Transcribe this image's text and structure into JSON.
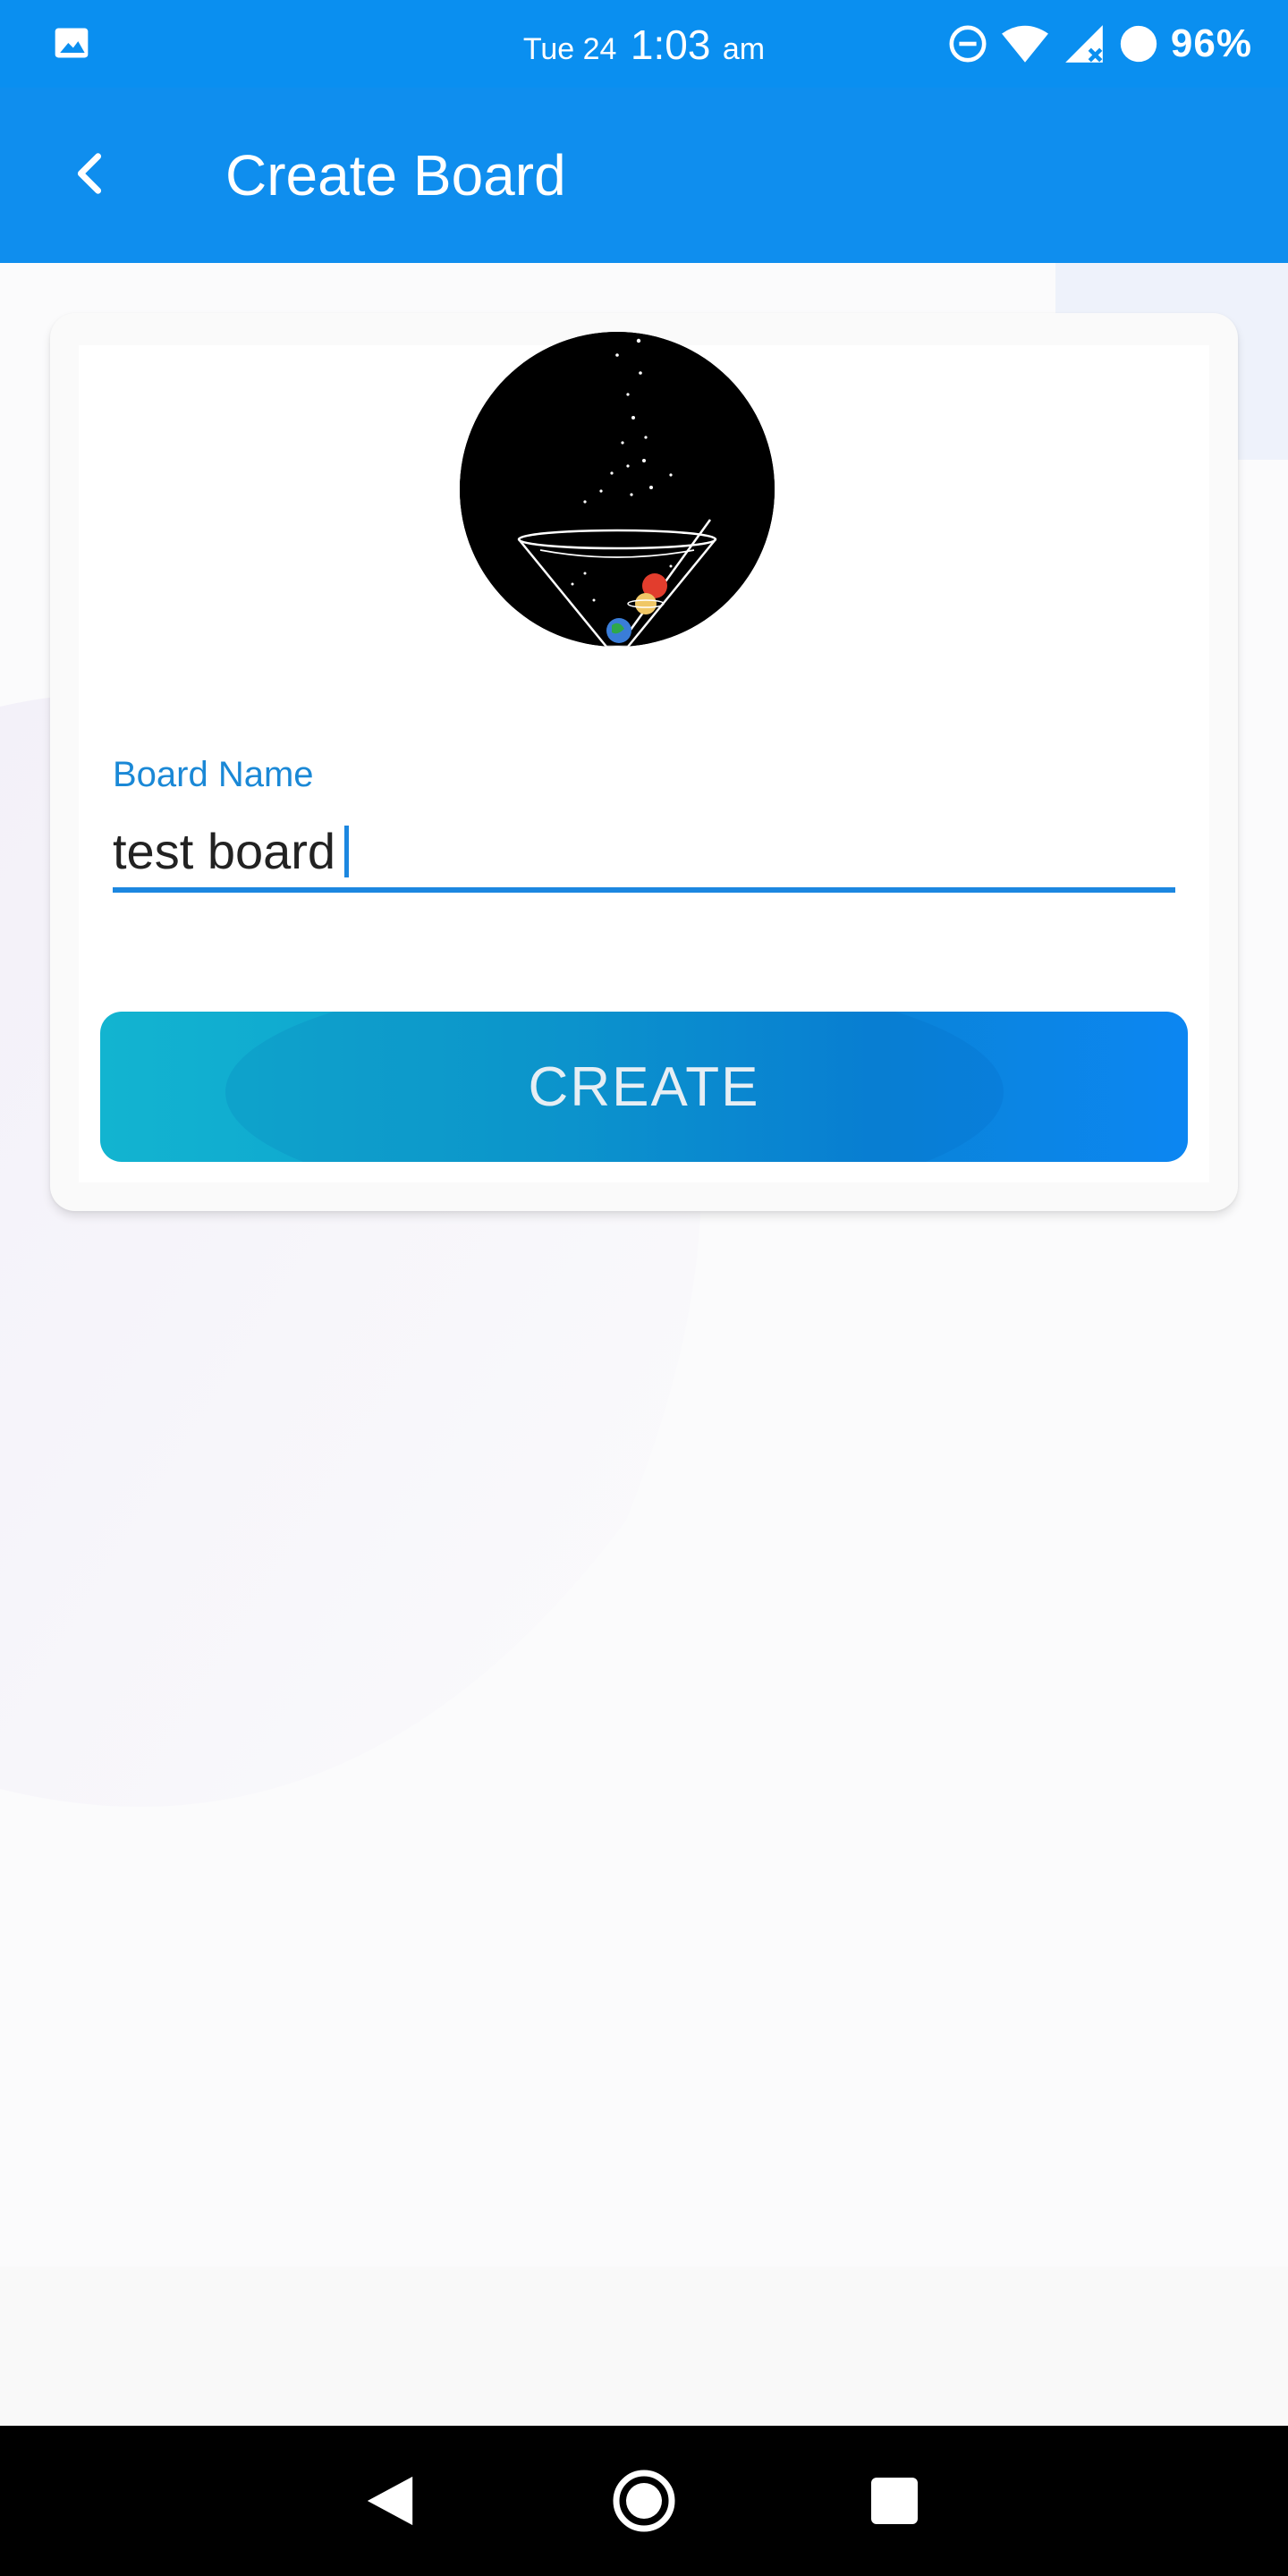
{
  "status_bar": {
    "day": "Tue 24",
    "time": "1:03",
    "ampm": "am",
    "battery": "96%",
    "icons": [
      "gallery-icon",
      "do-not-disturb-icon",
      "wifi-icon",
      "cellular-signal-icon",
      "battery-icon"
    ]
  },
  "app_bar": {
    "title": "Create Board",
    "back_icon": "chevron-left-icon"
  },
  "form": {
    "board_name_label": "Board Name",
    "board_name_value": "test board",
    "create_label": "CREATE"
  },
  "nav_bar": {
    "icons": [
      "back-triangle-icon",
      "home-circle-icon",
      "recents-square-icon"
    ]
  },
  "colors": {
    "primary": "#0f8eee",
    "accent": "#1c87e0",
    "button_start": "#12b4d0",
    "button_end": "#0c86f2"
  }
}
